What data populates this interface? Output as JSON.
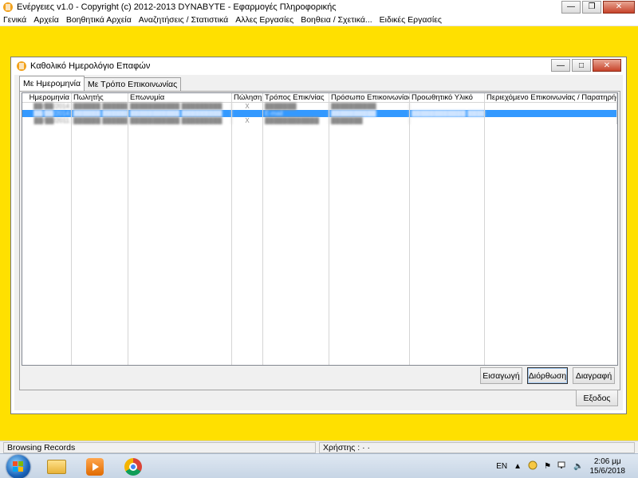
{
  "app": {
    "title": "Ενέργειες  v1.0  -  Copyright (c)  2012-2013  DYNABYTE - Εφαρμογές Πληροφορικής",
    "window_controls": [
      "minimize-icon",
      "maximize-icon",
      "close-icon"
    ]
  },
  "menu": {
    "items": [
      "Γενικά",
      "Αρχεία",
      "Βοηθητικά Αρχεία",
      "Αναζητήσεις / Στατιστικά",
      "Αλλες Εργασίες",
      "Βοηθεια / Σχετικά...",
      "Ειδικές Εργασίες"
    ]
  },
  "dialog": {
    "title": "Καθολικό Ημερολόγιο Επαφών",
    "tabs": [
      "Με Ημερομηνία",
      "Με Τρόπο Επικοινωνίας"
    ],
    "active_tab": 0,
    "grid": {
      "columns": [
        "Ημερομηνία",
        "Πωλητής",
        "Επωνυμία",
        "Πώληση",
        "Τρόπος Επικ/νίας",
        "Πρόσωπο Επικοινωνίας",
        "Προωθητικό Υλικό",
        "Περιεχόμενο Επικοινωνίας / Παρατηρήσεις"
      ],
      "rows": [
        {
          "cells": [
            "██/██/2014",
            "██████ ██████",
            "███████████ █████████",
            "X",
            "███████",
            "██████████",
            "",
            ""
          ],
          "selected": false
        },
        {
          "cells": [
            "██/██/2014",
            "██████ ██████",
            "███████████ █████████",
            "",
            "E-mail",
            "██████████",
            "████████████ ████",
            ""
          ],
          "selected": true
        },
        {
          "cells": [
            "██/██/2011",
            "██████ ██████",
            "███████████ █████████",
            "X",
            "████████████",
            "███████",
            "",
            ""
          ],
          "selected": false
        }
      ]
    },
    "buttons": {
      "insert": "Εισαγωγή",
      "edit": "Διόρθωση",
      "delete": "Διαγραφή",
      "exit": "Εξοδος"
    }
  },
  "statusbar": {
    "status": "Browsing Records",
    "user": "Χρήστης :  ·  ·"
  },
  "taskbar": {
    "language": "EN",
    "time": "2:06 μμ",
    "date": "15/6/2018"
  }
}
